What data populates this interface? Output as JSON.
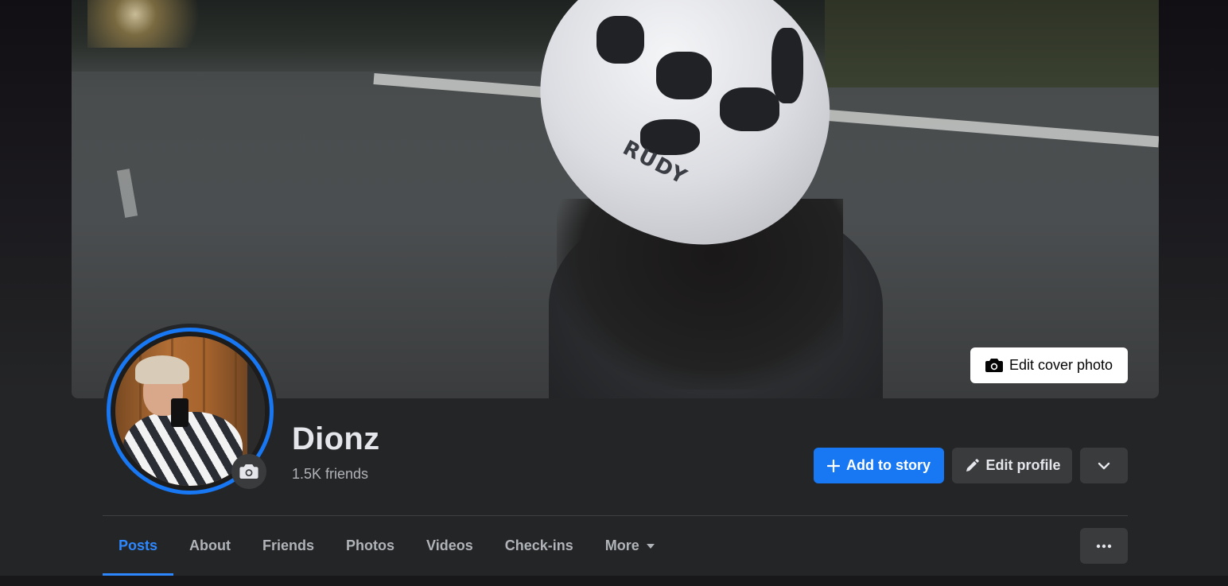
{
  "cover": {
    "edit_label": "Edit cover photo",
    "helmet_text": "RUDY"
  },
  "profile": {
    "name": "Dionz",
    "friends": "1.5K friends"
  },
  "actions": {
    "add_story": "Add to story",
    "edit_profile": "Edit profile"
  },
  "tabs": [
    {
      "label": "Posts",
      "active": true
    },
    {
      "label": "About"
    },
    {
      "label": "Friends"
    },
    {
      "label": "Photos"
    },
    {
      "label": "Videos"
    },
    {
      "label": "Check-ins"
    },
    {
      "label": "More"
    }
  ],
  "icons": {
    "camera": "camera-icon",
    "plus": "plus-icon",
    "pencil": "pencil-icon",
    "chevron": "chevron-down-icon",
    "caret": "caret-down-icon",
    "dots": "more-dots-icon"
  },
  "colors": {
    "accent": "#1877f2",
    "tab_active": "#2d88ff",
    "button_secondary": "#3a3b3c",
    "surface": "#242526"
  }
}
